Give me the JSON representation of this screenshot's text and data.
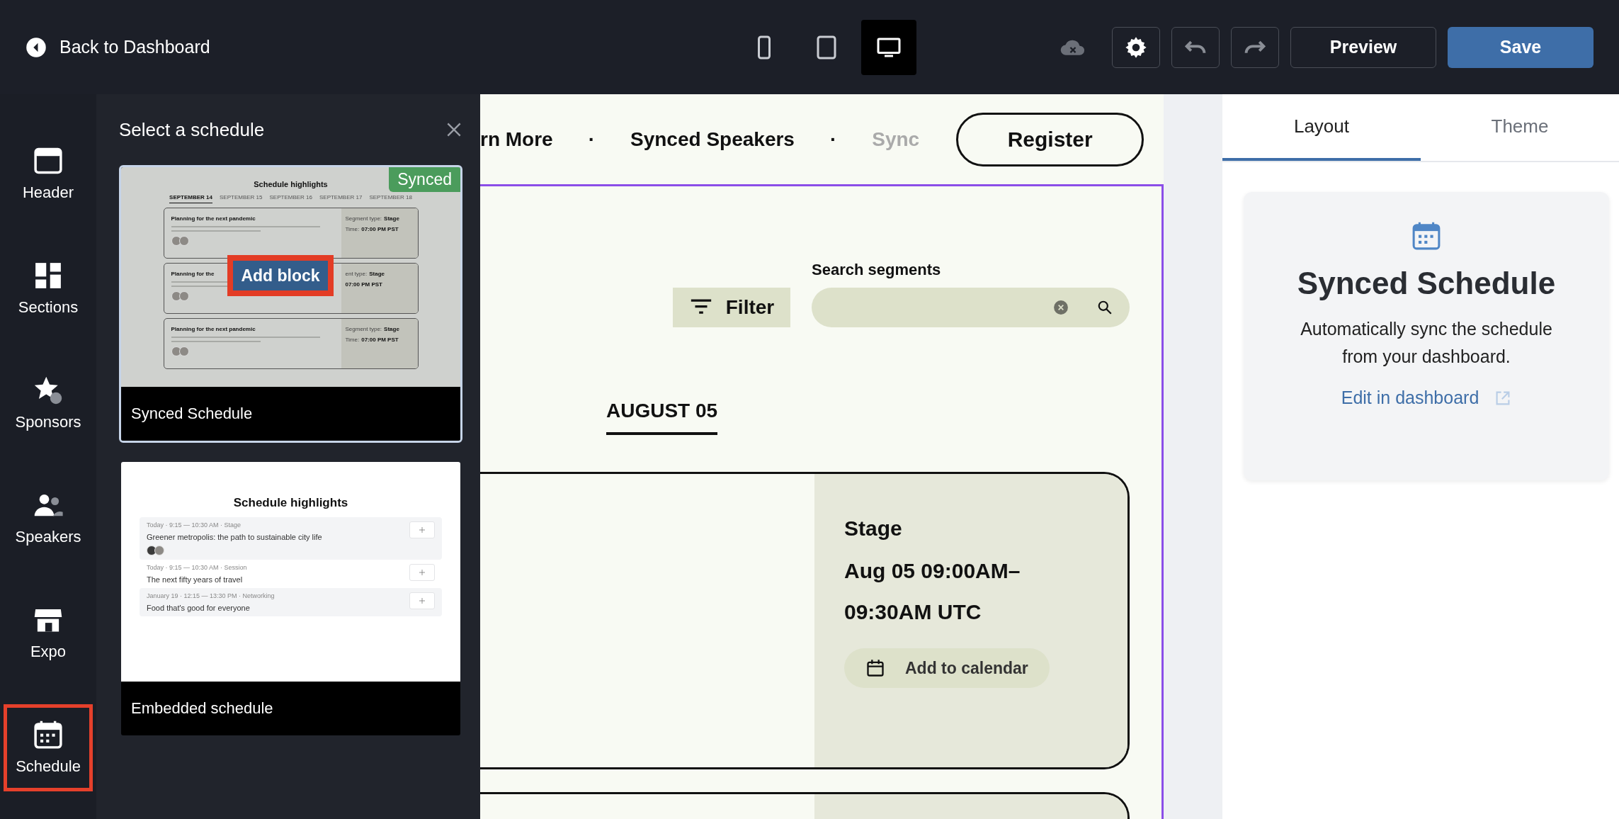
{
  "topbar": {
    "back_label": "Back to Dashboard",
    "devices": [
      {
        "kind": "phone",
        "selected": false
      },
      {
        "kind": "tablet",
        "selected": false
      },
      {
        "kind": "desktop",
        "selected": true
      }
    ],
    "preview_label": "Preview",
    "save_label": "Save"
  },
  "rail": [
    {
      "kind": "header",
      "label": "Header",
      "selected": false
    },
    {
      "kind": "sections",
      "label": "Sections",
      "selected": false
    },
    {
      "kind": "sponsors",
      "label": "Sponsors",
      "selected": false
    },
    {
      "kind": "speakers",
      "label": "Speakers",
      "selected": false
    },
    {
      "kind": "expo",
      "label": "Expo",
      "selected": false
    },
    {
      "kind": "schedule",
      "label": "Schedule",
      "selected": true
    }
  ],
  "panel": {
    "title": "Select a schedule",
    "options": [
      {
        "kind": "synced",
        "name": "Synced Schedule",
        "selected": true,
        "badge": "Synced",
        "action": "Add block",
        "preview": {
          "title": "Schedule highlights",
          "dates": [
            {
              "label": "SEPTEMBER 14",
              "selected": true
            },
            {
              "label": "SEPTEMBER 15",
              "selected": false
            },
            {
              "label": "SEPTEMBER 16",
              "selected": false
            },
            {
              "label": "SEPTEMBER 17",
              "selected": false
            },
            {
              "label": "SEPTEMBER 18",
              "selected": false
            }
          ],
          "sessions": [
            {
              "title": "Planning for the next pandemic",
              "segment_label": "Segment type:",
              "segment": "Stage",
              "time_label": "Time:",
              "time": "07:00 PM PST"
            },
            {
              "title": "Planning for the",
              "segment_label": "ent type:",
              "segment": "Stage",
              "time": "07:00 PM PST"
            },
            {
              "title": "Planning for the next pandemic",
              "segment_label": "Segment type:",
              "segment": "Stage",
              "time_label": "Time:",
              "time": "07:00 PM PST"
            }
          ]
        }
      },
      {
        "kind": "embedded",
        "name": "Embedded schedule",
        "selected": false,
        "preview": {
          "title": "Schedule highlights",
          "items": [
            {
              "meta": "Today · 9:15 — 10:30 AM · Stage",
              "title": "Greener metropolis: the path to sustainable city life",
              "has_speakers": true,
              "shaded": true
            },
            {
              "meta": "Today · 9:15 — 10:30 AM · Session",
              "title": "The next fifty years of travel",
              "has_speakers": false,
              "shaded": false
            },
            {
              "meta": "January 19 · 12:15 — 13:30 PM · Networking",
              "title": "Food that's good for everyone",
              "has_speakers": false,
              "shaded": true
            }
          ]
        }
      }
    ]
  },
  "canvas": {
    "nav": [
      {
        "label": "rn More",
        "kind": "link",
        "faded": false
      },
      {
        "label": "·",
        "kind": "separator",
        "faded": false
      },
      {
        "label": "Synced Speakers",
        "kind": "link",
        "faded": false
      },
      {
        "label": "·",
        "kind": "separator",
        "faded": false
      },
      {
        "label": "Sync",
        "kind": "link",
        "faded": true
      }
    ],
    "register_label": "Register",
    "filter_label": "Filter",
    "search_label": "Search segments",
    "dates": [
      {
        "label": "AUGUST 05",
        "selected": true
      }
    ],
    "sessions": [
      {
        "segment": "Stage",
        "time": "Aug 05 09:00AM–09:30AM UTC",
        "calendar_label": "Add to calendar"
      }
    ]
  },
  "inspector": {
    "tabs": [
      {
        "label": "Layout",
        "selected": true
      },
      {
        "label": "Theme",
        "selected": false
      }
    ],
    "title": "Synced Schedule",
    "description": "Automatically sync the schedule from your dashboard.",
    "link": "Edit in dashboard"
  }
}
